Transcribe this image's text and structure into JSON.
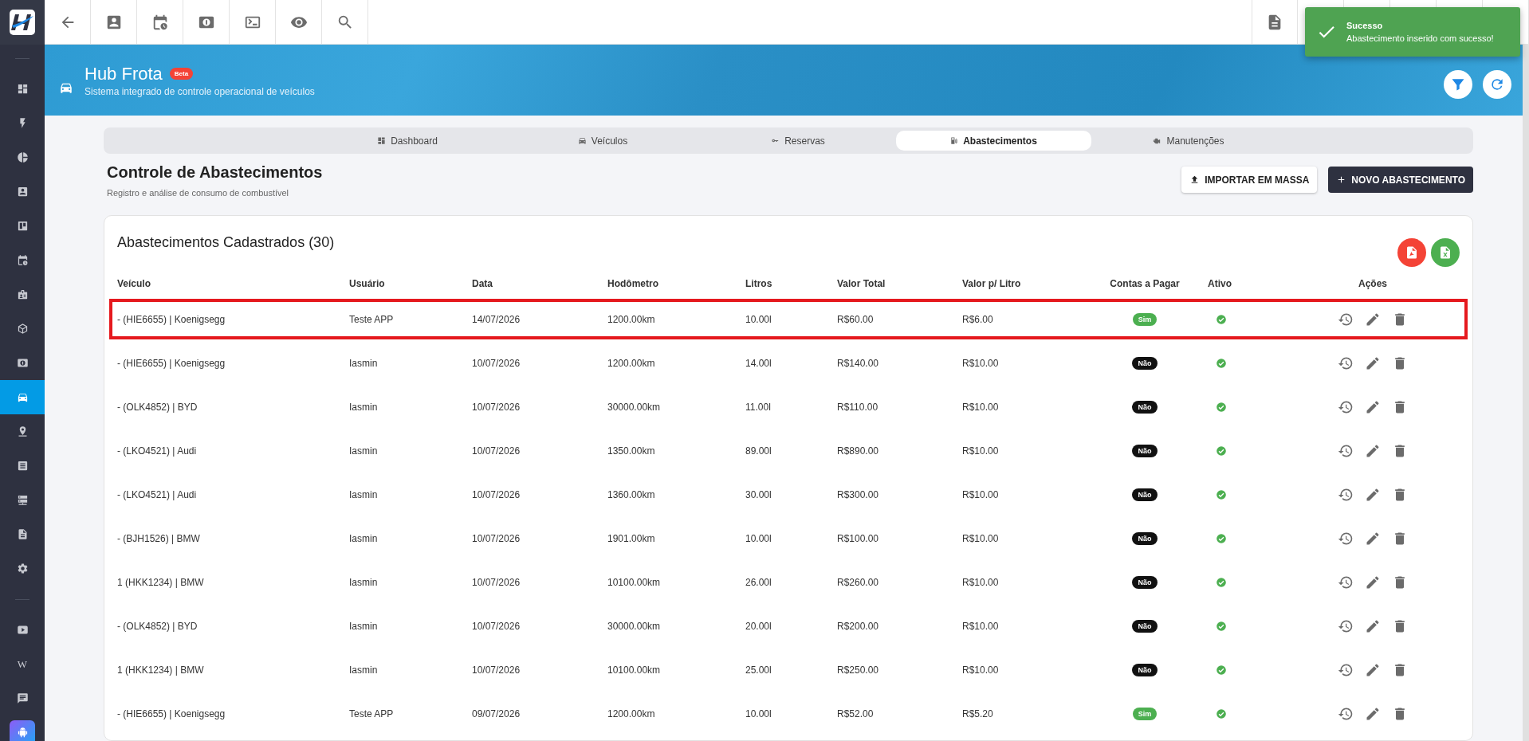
{
  "sidebar": {
    "items": [
      {
        "selected": false
      },
      {
        "selected": false
      },
      {
        "selected": false
      },
      {
        "selected": false
      },
      {
        "selected": false
      },
      {
        "selected": false
      },
      {
        "selected": false
      },
      {
        "selected": false
      },
      {
        "selected": false
      },
      {
        "selected": true
      },
      {
        "selected": false
      },
      {
        "selected": false
      },
      {
        "selected": false
      },
      {
        "selected": false
      },
      {
        "selected": false
      }
    ],
    "wiki_label": "W"
  },
  "toast": {
    "title": "Sucesso",
    "message": "Abastecimento inserido com sucesso!"
  },
  "header": {
    "title": "Hub Frota",
    "badge": "Beta",
    "subtitle": "Sistema integrado de controle operacional de veículos"
  },
  "tabs": [
    {
      "label": "Dashboard",
      "selected": false
    },
    {
      "label": "Veículos",
      "selected": false
    },
    {
      "label": "Reservas",
      "selected": false
    },
    {
      "label": "Abastecimentos",
      "selected": true
    },
    {
      "label": "Manutenções",
      "selected": false
    }
  ],
  "page": {
    "title": "Controle de Abastecimentos",
    "subtitle": "Registro e análise de consumo de combustível"
  },
  "actions": [
    {
      "label": "IMPORTAR EM MASSA",
      "kind": "outline"
    },
    {
      "label": "NOVO ABASTECIMENTO",
      "kind": "dark"
    }
  ],
  "table": {
    "title": "Abastecimentos Cadastrados (30)",
    "exports": [
      {
        "color": "#f44336"
      },
      {
        "color": "#4caf50"
      }
    ],
    "columns": [
      "Veículo",
      "Usuário",
      "Data",
      "Hodômetro",
      "Litros",
      "Valor Total",
      "Valor p/ Litro",
      "Contas a Pagar",
      "Ativo",
      "Ações"
    ],
    "rows": [
      {
        "veiculo": "- (HIE6655) | Koenigsegg",
        "usuario": "Teste APP",
        "data": "14/07/2026",
        "hodometro": "1200.00km",
        "litros": "10.00l",
        "valor_total": "R$60.00",
        "valor_litro": "R$6.00",
        "contas_a_pagar": {
          "label": "Sim",
          "on": true
        },
        "ativo": true,
        "selected": true
      },
      {
        "veiculo": "- (HIE6655) | Koenigsegg",
        "usuario": "Iasmin",
        "data": "10/07/2026",
        "hodometro": "1200.00km",
        "litros": "14.00l",
        "valor_total": "R$140.00",
        "valor_litro": "R$10.00",
        "contas_a_pagar": {
          "label": "Não",
          "on": false
        },
        "ativo": true,
        "selected": false
      },
      {
        "veiculo": "- (OLK4852) | BYD",
        "usuario": "Iasmin",
        "data": "10/07/2026",
        "hodometro": "30000.00km",
        "litros": "11.00l",
        "valor_total": "R$110.00",
        "valor_litro": "R$10.00",
        "contas_a_pagar": {
          "label": "Não",
          "on": false
        },
        "ativo": true,
        "selected": false
      },
      {
        "veiculo": "- (LKO4521) | Audi",
        "usuario": "Iasmin",
        "data": "10/07/2026",
        "hodometro": "1350.00km",
        "litros": "89.00l",
        "valor_total": "R$890.00",
        "valor_litro": "R$10.00",
        "contas_a_pagar": {
          "label": "Não",
          "on": false
        },
        "ativo": true,
        "selected": false
      },
      {
        "veiculo": "- (LKO4521) | Audi",
        "usuario": "Iasmin",
        "data": "10/07/2026",
        "hodometro": "1360.00km",
        "litros": "30.00l",
        "valor_total": "R$300.00",
        "valor_litro": "R$10.00",
        "contas_a_pagar": {
          "label": "Não",
          "on": false
        },
        "ativo": true,
        "selected": false
      },
      {
        "veiculo": "- (BJH1526) | BMW",
        "usuario": "Iasmin",
        "data": "10/07/2026",
        "hodometro": "1901.00km",
        "litros": "10.00l",
        "valor_total": "R$100.00",
        "valor_litro": "R$10.00",
        "contas_a_pagar": {
          "label": "Não",
          "on": false
        },
        "ativo": true,
        "selected": false
      },
      {
        "veiculo": "1 (HKK1234) | BMW",
        "usuario": "Iasmin",
        "data": "10/07/2026",
        "hodometro": "10100.00km",
        "litros": "26.00l",
        "valor_total": "R$260.00",
        "valor_litro": "R$10.00",
        "contas_a_pagar": {
          "label": "Não",
          "on": false
        },
        "ativo": true,
        "selected": false
      },
      {
        "veiculo": "- (OLK4852) | BYD",
        "usuario": "Iasmin",
        "data": "10/07/2026",
        "hodometro": "30000.00km",
        "litros": "20.00l",
        "valor_total": "R$200.00",
        "valor_litro": "R$10.00",
        "contas_a_pagar": {
          "label": "Não",
          "on": false
        },
        "ativo": true,
        "selected": false
      },
      {
        "veiculo": "1 (HKK1234) | BMW",
        "usuario": "Iasmin",
        "data": "10/07/2026",
        "hodometro": "10100.00km",
        "litros": "25.00l",
        "valor_total": "R$250.00",
        "valor_litro": "R$10.00",
        "contas_a_pagar": {
          "label": "Não",
          "on": false
        },
        "ativo": true,
        "selected": false
      },
      {
        "veiculo": "- (HIE6655) | Koenigsegg",
        "usuario": "Teste APP",
        "data": "09/07/2026",
        "hodometro": "1200.00km",
        "litros": "10.00l",
        "valor_total": "R$52.00",
        "valor_litro": "R$5.20",
        "contas_a_pagar": {
          "label": "Sim",
          "on": true
        },
        "ativo": true,
        "selected": false
      }
    ]
  }
}
